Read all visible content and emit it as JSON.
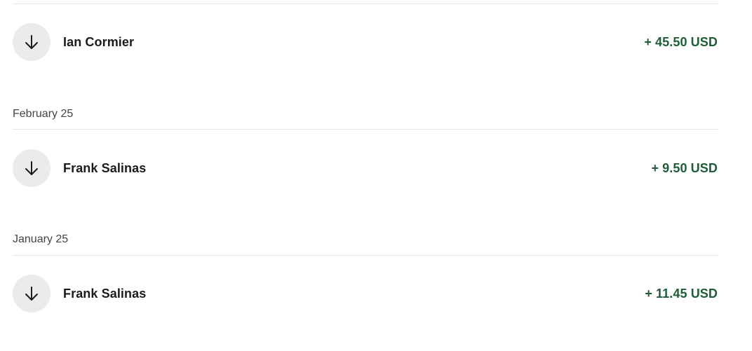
{
  "transactions_feed": {
    "entries": [
      {
        "date_label": "",
        "counterparty": "Ian Cormier",
        "amount": "+ 45.50 USD",
        "direction_icon": "arrow-down-icon"
      },
      {
        "date_label": "February 25",
        "counterparty": "Frank Salinas",
        "amount": "+ 9.50 USD",
        "direction_icon": "arrow-down-icon"
      },
      {
        "date_label": "January 25",
        "counterparty": "Frank Salinas",
        "amount": "+ 11.45 USD",
        "direction_icon": "arrow-down-icon"
      }
    ]
  },
  "colors": {
    "amount_positive": "#1e5e36",
    "icon_background": "#ebece9",
    "divider": "#e6e6e3",
    "date_text": "#444444"
  }
}
